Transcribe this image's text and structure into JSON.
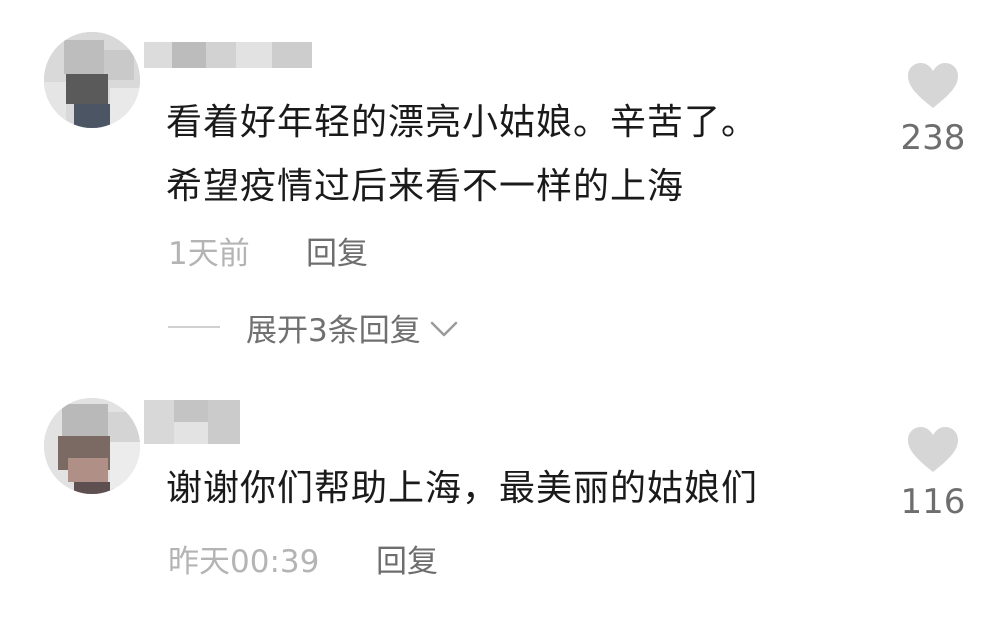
{
  "comments": [
    {
      "text_lines": [
        "看着好年轻的漂亮小姑娘。辛苦了。",
        "希望疫情过后来看不一样的上海"
      ],
      "time": "1天前",
      "reply_label": "回复",
      "likes": "238",
      "expand_label": "展开3条回复"
    },
    {
      "text_lines": [
        "谢谢你们帮助上海，最美丽的姑娘们"
      ],
      "time": "昨天00:39",
      "reply_label": "回复",
      "likes": "116"
    }
  ],
  "icons": {
    "like": "heart-icon",
    "expand": "chevron-down-icon"
  },
  "colors": {
    "text": "#1a1a1a",
    "meta": "#b4b4b4",
    "secondary": "#6e6e6e",
    "heart": "#d6d6d6"
  }
}
